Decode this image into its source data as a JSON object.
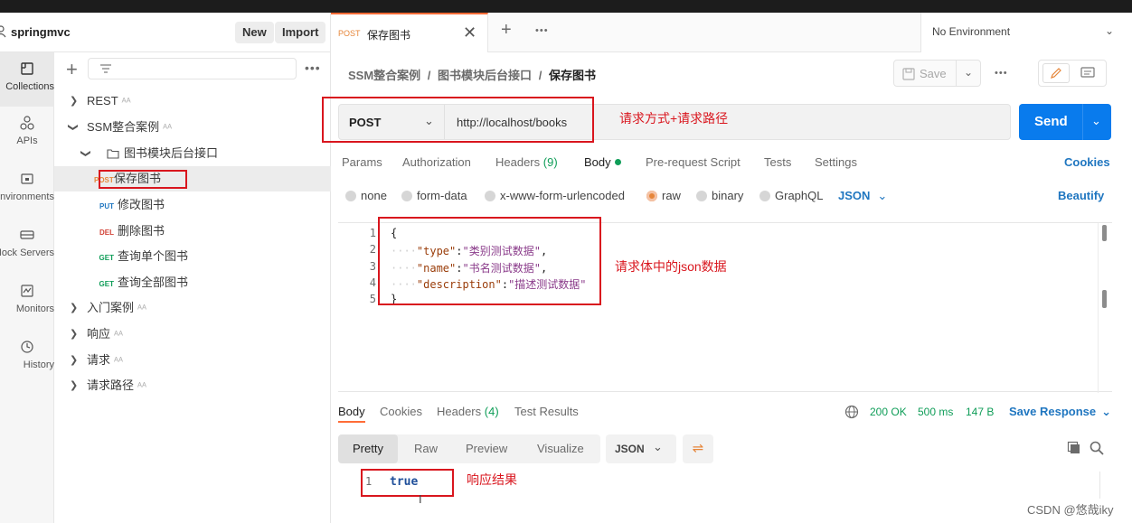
{
  "workspace": {
    "name": "springmvc",
    "new_label": "New",
    "import_label": "Import"
  },
  "rail": [
    {
      "label": "Collections",
      "icon": "collections-icon"
    },
    {
      "label": "APIs",
      "icon": "apis-icon"
    },
    {
      "label": "Environments",
      "icon": "environments-icon"
    },
    {
      "label": "Mock Servers",
      "icon": "mock-servers-icon"
    },
    {
      "label": "Monitors",
      "icon": "monitors-icon"
    },
    {
      "label": "History",
      "icon": "history-icon"
    }
  ],
  "tree": {
    "rest": "REST",
    "ssm": "SSM整合案例",
    "folder": "图书模块后台接口",
    "requests": [
      {
        "method": "POST",
        "name": "保存图书"
      },
      {
        "method": "PUT",
        "name": "修改图书"
      },
      {
        "method": "DEL",
        "name": "删除图书"
      },
      {
        "method": "GET",
        "name": "查询单个图书"
      },
      {
        "method": "GET",
        "name": "查询全部图书"
      }
    ],
    "others": [
      "入门案例",
      "响应",
      "请求",
      "请求路径"
    ]
  },
  "tab": {
    "method": "POST",
    "title": "保存图书"
  },
  "environment": "No Environment",
  "breadcrumb": {
    "part1": "SSM整合案例",
    "part2": "图书模块后台接口",
    "current": "保存图书",
    "sep": "/"
  },
  "save_label": "Save",
  "request": {
    "method": "POST",
    "url": "http://localhost/books",
    "send_label": "Send"
  },
  "annotations": {
    "url": "请求方式+请求路径",
    "body": "请求体中的json数据",
    "response": "响应结果"
  },
  "req_tabs": {
    "params": "Params",
    "authorization": "Authorization",
    "headers": "Headers",
    "headers_count": "(9)",
    "body": "Body",
    "prerequest": "Pre-request Script",
    "tests": "Tests",
    "settings": "Settings",
    "cookies": "Cookies"
  },
  "body_types": [
    "none",
    "form-data",
    "x-www-form-urlencoded",
    "raw",
    "binary",
    "GraphQL"
  ],
  "body_format": "JSON",
  "beautify": "Beautify",
  "code": {
    "line_numbers": [
      "1",
      "2",
      "3",
      "4",
      "5"
    ],
    "open": "{",
    "close": "}",
    "k1": "\"type\"",
    "v1": "\"类别测试数据\"",
    "k2": "\"name\"",
    "v2": "\"书名测试数据\"",
    "k3": "\"description\"",
    "v3": "\"描述测试数据\""
  },
  "resp_tabs": {
    "body": "Body",
    "cookies": "Cookies",
    "headers": "Headers",
    "headers_count": "(4)",
    "test_results": "Test Results"
  },
  "status": {
    "code": "200 OK",
    "time": "500 ms",
    "size": "147 B",
    "save_response": "Save Response"
  },
  "resp_views": [
    "Pretty",
    "Raw",
    "Preview",
    "Visualize"
  ],
  "resp_format": "JSON",
  "response": {
    "line": "1",
    "value": "true"
  },
  "watermark": "CSDN @悠哉iky",
  "colors": {
    "accent": "#ff6c37",
    "send": "#097bed",
    "annotation": "#d9161e",
    "success": "#0f9d58"
  }
}
